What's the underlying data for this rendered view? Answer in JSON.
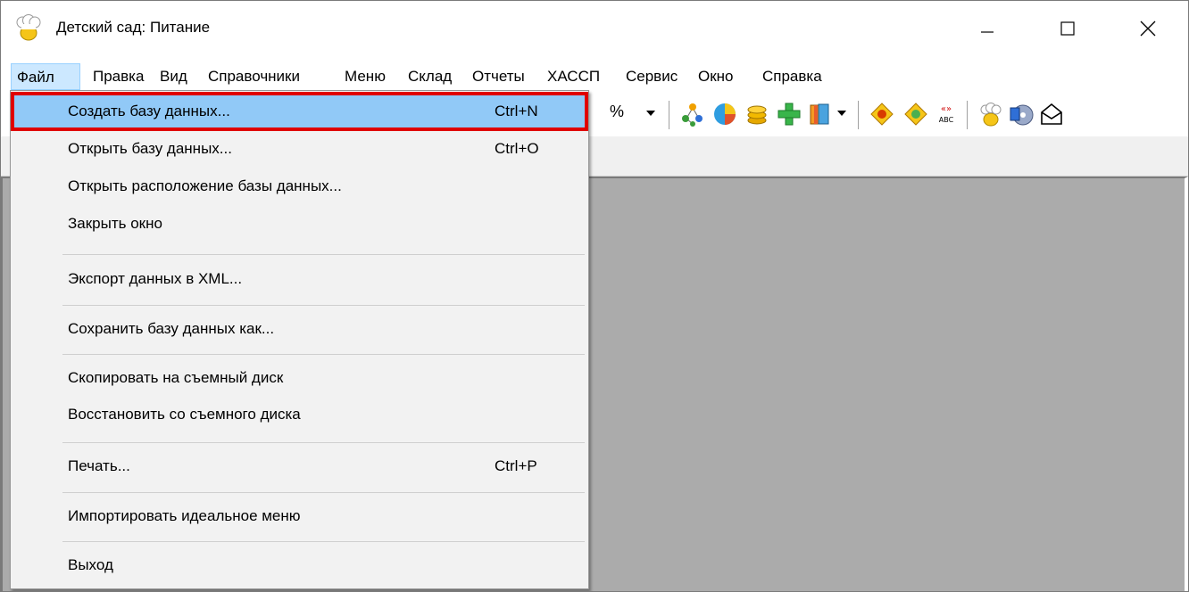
{
  "window": {
    "title": "Детский сад: Питание",
    "app_icon": "chef-hat-icon",
    "controls": [
      "minimize-icon",
      "maximize-icon",
      "close-icon"
    ]
  },
  "menubar": {
    "items": [
      "Файл",
      "Правка",
      "Вид",
      "Справочники",
      "Меню",
      "Склад",
      "Отчеты",
      "ХАССП",
      "Сервис",
      "Окно",
      "Справка"
    ],
    "active": "Файл"
  },
  "toolbar": {
    "percent_label": "%",
    "icons": [
      "tree-icon",
      "pie-chart-icon",
      "coins-icon",
      "plus-icon",
      "book-icon",
      "warning-icon",
      "warning-icon",
      "abc-icon",
      "chef-hat-icon",
      "disk-icon",
      "envelope-icon"
    ]
  },
  "file_menu": {
    "items": [
      {
        "label": "Создать базу данных...",
        "shortcut": "Ctrl+N",
        "highlighted": true
      },
      {
        "label": "Открыть базу данных...",
        "shortcut": "Ctrl+O"
      },
      {
        "label": "Открыть расположение базы данных...",
        "shortcut": ""
      },
      {
        "label": "Закрыть окно",
        "shortcut": ""
      },
      {
        "label": "Экспорт данных в XML...",
        "shortcut": ""
      },
      {
        "label": "Сохранить базу данных как...",
        "shortcut": ""
      },
      {
        "label": "Скопировать на съемный диск",
        "shortcut": ""
      },
      {
        "label": "Восстановить со съемного диска",
        "shortcut": ""
      },
      {
        "label": "Печать...",
        "shortcut": "Ctrl+P"
      },
      {
        "label": "Импортировать идеальное меню",
        "shortcut": ""
      },
      {
        "label": "Выход",
        "shortcut": ""
      }
    ]
  },
  "colors": {
    "highlight": "#91c9f7",
    "highlight_frame": "#e00000",
    "workspace": "#ababab",
    "menu_bg": "#f2f2f2"
  }
}
